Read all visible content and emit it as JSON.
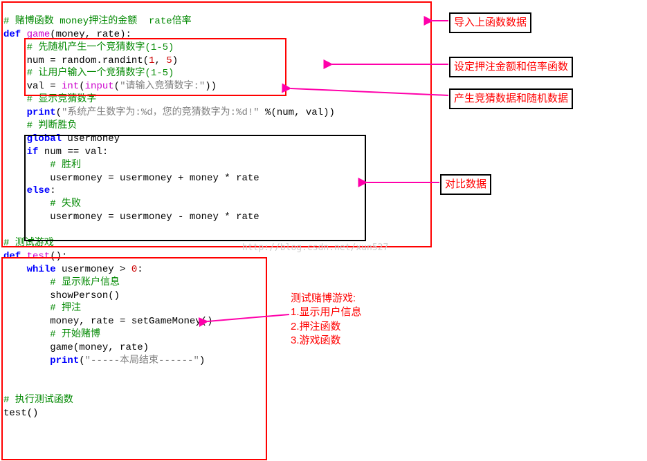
{
  "code": {
    "l1_cmt": "# 赌博函数 money押注的金额  rate倍率",
    "l2_def": "def",
    "l2_fn": "game",
    "l2_paren1": "(",
    "l2_args": "money, rate",
    "l2_paren2": "):",
    "l3_cmt": "# 先随机产生一个竞猜数字(1-5)",
    "l4_a": "num ",
    "l4_eq": "=",
    "l4_b": " random.",
    "l4_fn": "randint",
    "l4_p1": "(",
    "l4_n1": "1",
    "l4_com": ", ",
    "l4_n2": "5",
    "l4_p2": ")",
    "l5_cmt": "# 让用户输入一个竞猜数字(1-5)",
    "l6_a": "val ",
    "l6_eq": "=",
    "l6_int": " int",
    "l6_p1": "(",
    "l6_inp": "input",
    "l6_p2": "(",
    "l6_str": "\"请输入竞猜数字:\"",
    "l6_p3": "))",
    "l7_cmt": "# 显示竞猜数字",
    "l8_print": "print",
    "l8_p1": "(",
    "l8_str": "\"系统产生数字为:%d，您的竞猜数字为:%d!\"",
    "l8_pct": " %",
    "l8_p2": "(",
    "l8_args": "num, val",
    "l8_p3": "))",
    "l9_cmt": "# 判断胜负",
    "l10_global": "global",
    "l10_var": " usermoney",
    "l11_if": "if",
    "l11_a": " num ",
    "l11_eq": "==",
    "l11_b": " val:",
    "l12_cmt": "# 胜利",
    "l13": "usermoney = usermoney + money * rate",
    "l14_else": "else",
    "l14_c": ":",
    "l15_cmt": "# 失败",
    "l16": "usermoney = usermoney - money * rate",
    "l18_cmt": "# 测试游戏",
    "l19_def": "def",
    "l19_fn": "test",
    "l19_p": "():",
    "l20_while": "while",
    "l20_a": " usermoney ",
    "l20_gt": ">",
    "l20_b": " ",
    "l20_n": "0",
    "l20_c": ":",
    "l21_cmt": "# 显示账户信息",
    "l22_fn": "showPerson",
    "l22_p": "()",
    "l23_cmt": "# 押注",
    "l24_a": "money, rate ",
    "l24_eq": "=",
    "l24_fn": " setGameMoney",
    "l24_p": "()",
    "l25_cmt": "# 开始赌博",
    "l26_fn": "game",
    "l26_p1": "(",
    "l26_args": "money, rate",
    "l26_p2": ")",
    "l27_print": "print",
    "l27_p1": "(",
    "l27_str": "\"-----本局结束------\"",
    "l27_p2": ")",
    "l29_cmt": "# 执行测试函数",
    "l30_fn": "test",
    "l30_p": "()"
  },
  "annot": {
    "a1": "导入上函数数据",
    "a2": "设定押注金额和倍率函数",
    "a3": "产生竞猜数据和随机数据",
    "a4": "对比数据",
    "a5": "测试赌博游戏:\n1.显示用户信息\n2.押注函数\n3.游戏函数"
  },
  "watermark": "http://blog.csdn.net/xun527"
}
